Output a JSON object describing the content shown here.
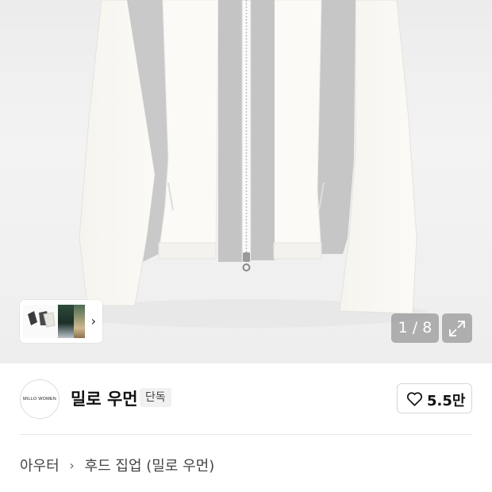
{
  "gallery": {
    "current": "1",
    "total": "8",
    "counter_text": "1 / 8",
    "thumbnails": [
      "product-thumb-1",
      "product-thumb-2",
      "product-thumb-3"
    ],
    "next_icon": "chevron-right-icon",
    "expand_icon": "expand-icon"
  },
  "brand": {
    "logo_text": "MILLO WOMEN",
    "name": "밀로 우먼",
    "badge": "단독"
  },
  "like": {
    "icon": "heart-icon",
    "count": "5.5만"
  },
  "breadcrumb": {
    "category": "아우터",
    "separator_icon": "chevron-right-icon",
    "subcategory": "후드 집업 (밀로 우먼)"
  },
  "colors": {
    "background": "#ffffff",
    "overlay": "#787878",
    "badge_bg": "#f1f1f1"
  }
}
